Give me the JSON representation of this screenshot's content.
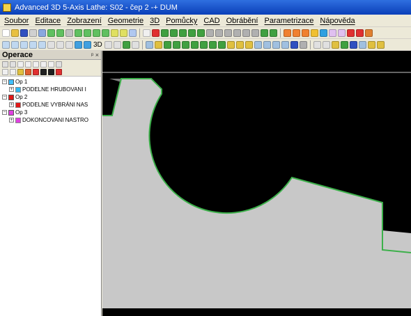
{
  "window": {
    "title": "Advanced 3D 5-Axis Lathe: S02 - čep 2 -+ DUM"
  },
  "menu": {
    "items": [
      "Soubor",
      "Editace",
      "Zobrazení",
      "Geometrie",
      "3D",
      "Pomůcky",
      "CAD",
      "Obrábění",
      "Parametrizace",
      "Nápověda"
    ]
  },
  "toolbar": {
    "mode_3d_label": "3D"
  },
  "panel": {
    "title": "Operace",
    "controls": "ᵖ ×",
    "tree": [
      {
        "name": "Op 1",
        "color": "#40c0ff",
        "child": {
          "label": "PODELNE HRUBOVANI I",
          "color": "#30b8f0"
        }
      },
      {
        "name": "Op 2",
        "color": "#e01818",
        "child": {
          "label": "PODELNE VYBRÁNI NAS",
          "color": "#e01818"
        }
      },
      {
        "name": "Op 3",
        "color": "#e040e0",
        "child": {
          "label": "DOKONCOVANI NASTRO",
          "color": "#e040e0"
        }
      }
    ]
  },
  "colors": {
    "titlebar": "#0a3fb8",
    "viewport_bg": "#000000",
    "part_fill": "#c8c8c8",
    "toolpath": "#3cb04a",
    "stock": "#7a7a7a"
  }
}
